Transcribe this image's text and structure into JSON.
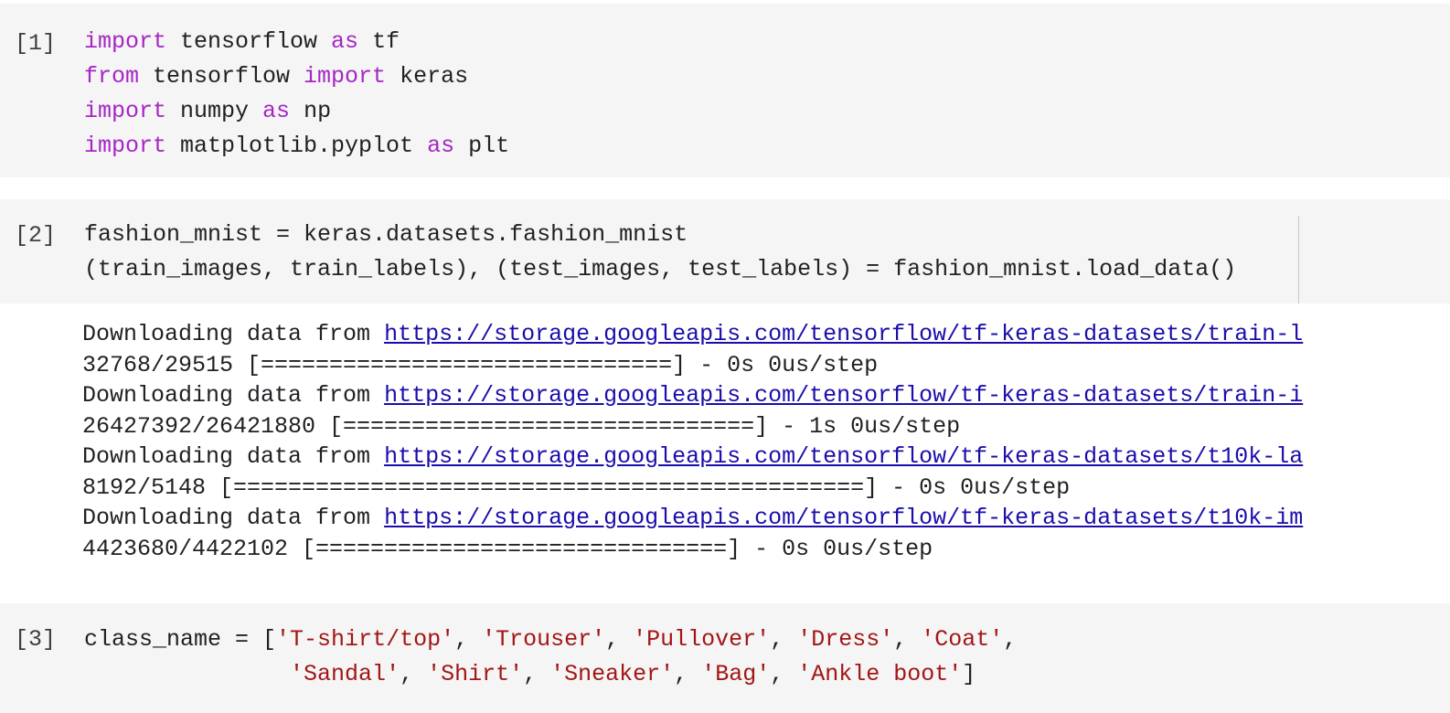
{
  "cells": [
    {
      "prompt": "[1]",
      "lines": [
        [
          {
            "t": "import",
            "k": "kw"
          },
          {
            "t": " tensorflow "
          },
          {
            "t": "as",
            "k": "kw"
          },
          {
            "t": " tf"
          }
        ],
        [
          {
            "t": "from",
            "k": "kw"
          },
          {
            "t": " tensorflow "
          },
          {
            "t": "import",
            "k": "kw"
          },
          {
            "t": " keras"
          }
        ],
        [
          {
            "t": "import",
            "k": "kw"
          },
          {
            "t": " numpy "
          },
          {
            "t": "as",
            "k": "kw"
          },
          {
            "t": " np"
          }
        ],
        [
          {
            "t": "import",
            "k": "kw"
          },
          {
            "t": " matplotlib.pyplot "
          },
          {
            "t": "as",
            "k": "kw"
          },
          {
            "t": " plt"
          }
        ]
      ]
    },
    {
      "prompt": "[2]",
      "lines": [
        [
          {
            "t": "fashion_mnist = keras.datasets.fashion_mnist"
          }
        ],
        [
          {
            "t": "(train_images, train_labels), (test_images, test_labels) = fashion_mnist.load_data()"
          }
        ]
      ],
      "output": [
        [
          {
            "t": "Downloading data from "
          },
          {
            "t": "https://storage.googleapis.com/tensorflow/tf-keras-datasets/train-l",
            "k": "link"
          }
        ],
        [
          {
            "t": "32768/29515 [==============================] - 0s 0us/step"
          }
        ],
        [
          {
            "t": "Downloading data from "
          },
          {
            "t": "https://storage.googleapis.com/tensorflow/tf-keras-datasets/train-i",
            "k": "link"
          }
        ],
        [
          {
            "t": "26427392/26421880 [==============================] - 1s 0us/step"
          }
        ],
        [
          {
            "t": "Downloading data from "
          },
          {
            "t": "https://storage.googleapis.com/tensorflow/tf-keras-datasets/t10k-la",
            "k": "link"
          }
        ],
        [
          {
            "t": "8192/5148 [==============================================] - 0s 0us/step"
          }
        ],
        [
          {
            "t": "Downloading data from "
          },
          {
            "t": "https://storage.googleapis.com/tensorflow/tf-keras-datasets/t10k-im",
            "k": "link"
          }
        ],
        [
          {
            "t": "4423680/4422102 [==============================] - 0s 0us/step"
          }
        ]
      ]
    },
    {
      "prompt": "[3]",
      "lines": [
        [
          {
            "t": "class_name = ["
          },
          {
            "t": "'T-shirt/top'",
            "k": "str"
          },
          {
            "t": ", "
          },
          {
            "t": "'Trouser'",
            "k": "str"
          },
          {
            "t": ", "
          },
          {
            "t": "'Pullover'",
            "k": "str"
          },
          {
            "t": ", "
          },
          {
            "t": "'Dress'",
            "k": "str"
          },
          {
            "t": ", "
          },
          {
            "t": "'Coat'",
            "k": "str"
          },
          {
            "t": ","
          }
        ],
        [
          {
            "t": "               "
          },
          {
            "t": "'Sandal'",
            "k": "str"
          },
          {
            "t": ", "
          },
          {
            "t": "'Shirt'",
            "k": "str"
          },
          {
            "t": ", "
          },
          {
            "t": "'Sneaker'",
            "k": "str"
          },
          {
            "t": ", "
          },
          {
            "t": "'Bag'",
            "k": "str"
          },
          {
            "t": ", "
          },
          {
            "t": "'Ankle boot'",
            "k": "str"
          },
          {
            "t": "]"
          }
        ]
      ]
    }
  ]
}
